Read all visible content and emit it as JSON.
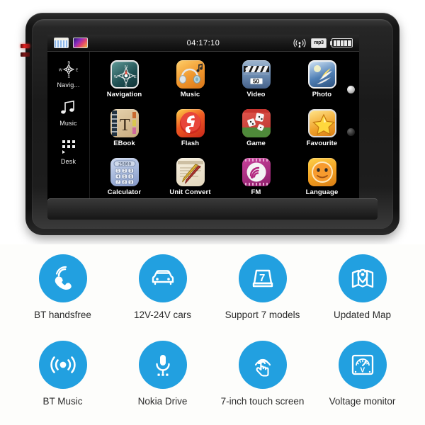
{
  "device": {
    "statusbar": {
      "clock": "04:17:10",
      "left_icons": [
        {
          "name": "grid-app-icon",
          "label": "grid"
        },
        {
          "name": "gradient-app-icon",
          "label": "gradient"
        }
      ],
      "wireless_icon": "wireless-signal-icon",
      "media_icon_label": "mp3",
      "battery_icon": "battery-full-icon",
      "battery_bars": 5
    },
    "sidebar": [
      {
        "label": "Navig...",
        "icon": "compass-icon"
      },
      {
        "label": "Music",
        "icon": "music-note-icon"
      },
      {
        "label": "Desk",
        "icon": "desktop-grid-icon"
      }
    ],
    "apps": [
      {
        "label": "Navigation",
        "icon": "compass-app-icon",
        "class": "ic-nav"
      },
      {
        "label": "Music",
        "icon": "headphones-app-icon",
        "class": "ic-music"
      },
      {
        "label": "Video",
        "icon": "clapperboard-app-icon",
        "class": "ic-video",
        "badge": "50"
      },
      {
        "label": "Photo",
        "icon": "photo-app-icon",
        "class": "ic-photo"
      },
      {
        "label": "EBook",
        "icon": "book-app-icon",
        "class": "ic-ebook",
        "glyph": "T"
      },
      {
        "label": "Flash",
        "icon": "flash-app-icon",
        "class": "ic-flash",
        "glyph": "f"
      },
      {
        "label": "Game",
        "icon": "dice-app-icon",
        "class": "ic-game"
      },
      {
        "label": "Favourite",
        "icon": "star-app-icon",
        "class": "ic-fav"
      },
      {
        "label": "Calculator",
        "icon": "calculator-app-icon",
        "class": "ic-calc",
        "display": "25800"
      },
      {
        "label": "Unit Convert",
        "icon": "unit-convert-app-icon",
        "class": "ic-unit"
      },
      {
        "label": "FM",
        "icon": "fm-radio-app-icon",
        "class": "ic-fm"
      },
      {
        "label": "Language",
        "icon": "smiley-app-icon",
        "class": "ic-lang"
      }
    ],
    "calculator_keys": [
      "1",
      "2",
      "3",
      "4",
      "5",
      "6",
      "7",
      "8",
      "9"
    ]
  },
  "features": [
    {
      "label": "BT handsfree",
      "icon": "phone-handset-icon"
    },
    {
      "label": "12V-24V cars",
      "icon": "car-icon"
    },
    {
      "label": "Support 7 models",
      "icon": "seven-models-icon"
    },
    {
      "label": "Updated Map",
      "icon": "map-pin-icon"
    },
    {
      "label": "BT Music",
      "icon": "broadcast-icon"
    },
    {
      "label": "Nokia Drive",
      "icon": "microphone-icon"
    },
    {
      "label": "7-inch touch screen",
      "icon": "touch-gesture-icon"
    },
    {
      "label": "Voltage monitor",
      "icon": "voltmeter-icon"
    }
  ],
  "colors": {
    "feature_blue": "#22a0e0",
    "page_background": "#fdfdfb",
    "screen_background": "#000000",
    "bezel": "#111111"
  }
}
